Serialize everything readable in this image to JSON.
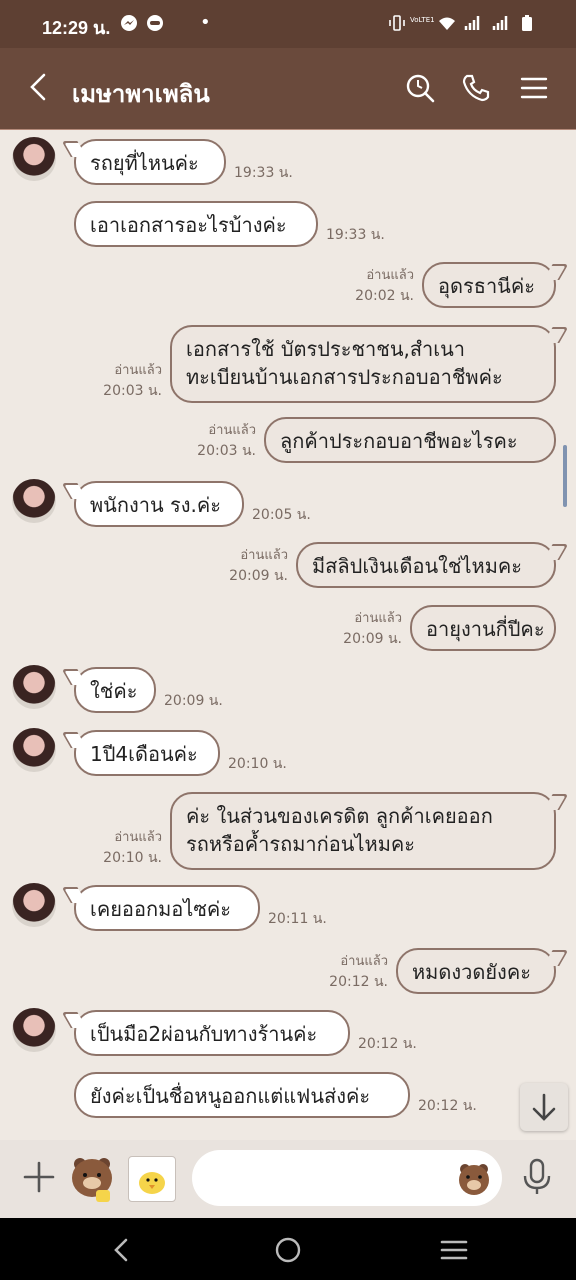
{
  "status_bar": {
    "time": "12:29 น.",
    "dot": "•",
    "lte_label": "VoLTE1"
  },
  "header": {
    "title": "เมษาพาเพลิน"
  },
  "messages": [
    {
      "dir": "in",
      "text": "รถยุที่ไหนค่ะ",
      "time": "19:33 น."
    },
    {
      "dir": "in",
      "text": "เอาเอกสารอะไรบ้างค่ะ",
      "time": "19:33 น."
    },
    {
      "dir": "out",
      "text": "อุดรธานีค่ะ",
      "read": "อ่านแล้ว",
      "time": "20:02 น."
    },
    {
      "dir": "out",
      "text": "เอกสารใช้ บัตรประชาชน,สำเนา\nทะเบียนบ้านเอกสารประกอบอาชีพค่ะ",
      "read": "อ่านแล้ว",
      "time": "20:03 น."
    },
    {
      "dir": "out",
      "text": "ลูกค้าประกอบอาชีพอะไรคะ",
      "read": "อ่านแล้ว",
      "time": "20:03 น."
    },
    {
      "dir": "in",
      "text": "พนักงาน รง.ค่ะ",
      "time": "20:05 น."
    },
    {
      "dir": "out",
      "text": "มีสลิปเงินเดือนใช่ไหมคะ",
      "read": "อ่านแล้ว",
      "time": "20:09 น."
    },
    {
      "dir": "out",
      "text": "อายุงานกี่ปีคะ",
      "read": "อ่านแล้ว",
      "time": "20:09 น."
    },
    {
      "dir": "in",
      "text": "ใช่ค่ะ",
      "time": "20:09 น."
    },
    {
      "dir": "in",
      "text": "1ปี4เดือนค่ะ",
      "time": "20:10 น."
    },
    {
      "dir": "out",
      "text": "ค่ะ ในส่วนของเครดิต ลูกค้าเคยออก\nรถหรือค้ำรถมาก่อนไหมคะ",
      "read": "อ่านแล้ว",
      "time": "20:10 น."
    },
    {
      "dir": "in",
      "text": "เคยออกมอไซค่ะ",
      "time": "20:11 น."
    },
    {
      "dir": "out",
      "text": "หมดงวดยังคะ",
      "read": "อ่านแล้ว",
      "time": "20:12 น."
    },
    {
      "dir": "in",
      "text": "เป็นมือ2ผ่อนกับทางร้านค่ะ",
      "time": "20:12 น."
    },
    {
      "dir": "in",
      "text": "ยังค่ะเป็นชื่อหนูออกแต่แฟนส่งค่ะ",
      "time": "20:12 น."
    }
  ],
  "input": {
    "placeholder": ""
  },
  "colors": {
    "header": "#6a4a3c",
    "status_bar": "#5e4033",
    "chat_bg": "#efe9e3",
    "bubble_border": "#8e746a"
  }
}
